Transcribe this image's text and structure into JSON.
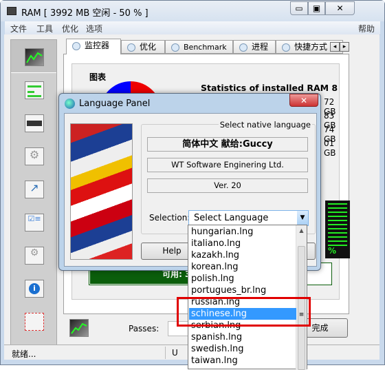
{
  "window": {
    "title": "RAM [ 3992 MB 空闲 - 50 % ]",
    "minimize": "▭",
    "maximize": "▣",
    "close": "✕"
  },
  "menu": {
    "items": [
      "文件",
      "工具",
      "优化",
      "选项"
    ],
    "help": "帮助"
  },
  "tabs": [
    {
      "label": "监控器",
      "active": true
    },
    {
      "label": "优化"
    },
    {
      "label": "Benchmark"
    },
    {
      "label": "进程"
    },
    {
      "label": "快捷方式"
    }
  ],
  "tab_scroll": {
    "left": "◂",
    "right": "▸"
  },
  "monitor": {
    "chart_label": "图表",
    "stats_title": "Statistics of installed RAM 8 GB:",
    "stats_values": [
      "72 GB",
      "83 GB",
      "74 GB",
      "01 GB"
    ],
    "available": "可用: 3.893",
    "meter_percent": "%"
  },
  "sidebar": {
    "icons": [
      "monitor-chart-icon",
      "bars-icon",
      "memory-chip-icon",
      "gears-settings-icon",
      "shortcut-arrow-icon",
      "checklist-icon",
      "gear-checklist-icon",
      "info-icon",
      "mail-icon"
    ]
  },
  "bottom": {
    "passes_label": "Passes:",
    "done_button": "完成"
  },
  "status": {
    "text": "就绪...",
    "text2": "U"
  },
  "dialog": {
    "title": "Language Panel",
    "group_label": "Select native language",
    "line1": "简体中文  献给:Guccy",
    "line2": "WT Software Enginering Ltd.",
    "line3": "Ver. 20",
    "selection_label": "Selection:",
    "selection_value": "Select Language",
    "help_button": "Help",
    "close": "✕",
    "options": [
      "hungarian.lng",
      "italiano.lng",
      "kazakh.lng",
      "korean.lng",
      "polish.lng",
      "portugues_br.lng",
      "russian.lng",
      "schinese.lng",
      "serbian.lng",
      "spanish.lng",
      "swedish.lng",
      "taiwan.lng"
    ],
    "selected_option": "schinese.lng"
  },
  "colors": {
    "highlight": "#3399ff",
    "annotation_box": "#e00000",
    "available_bar": "#0b5e0b",
    "meter_green": "#22ee22"
  }
}
